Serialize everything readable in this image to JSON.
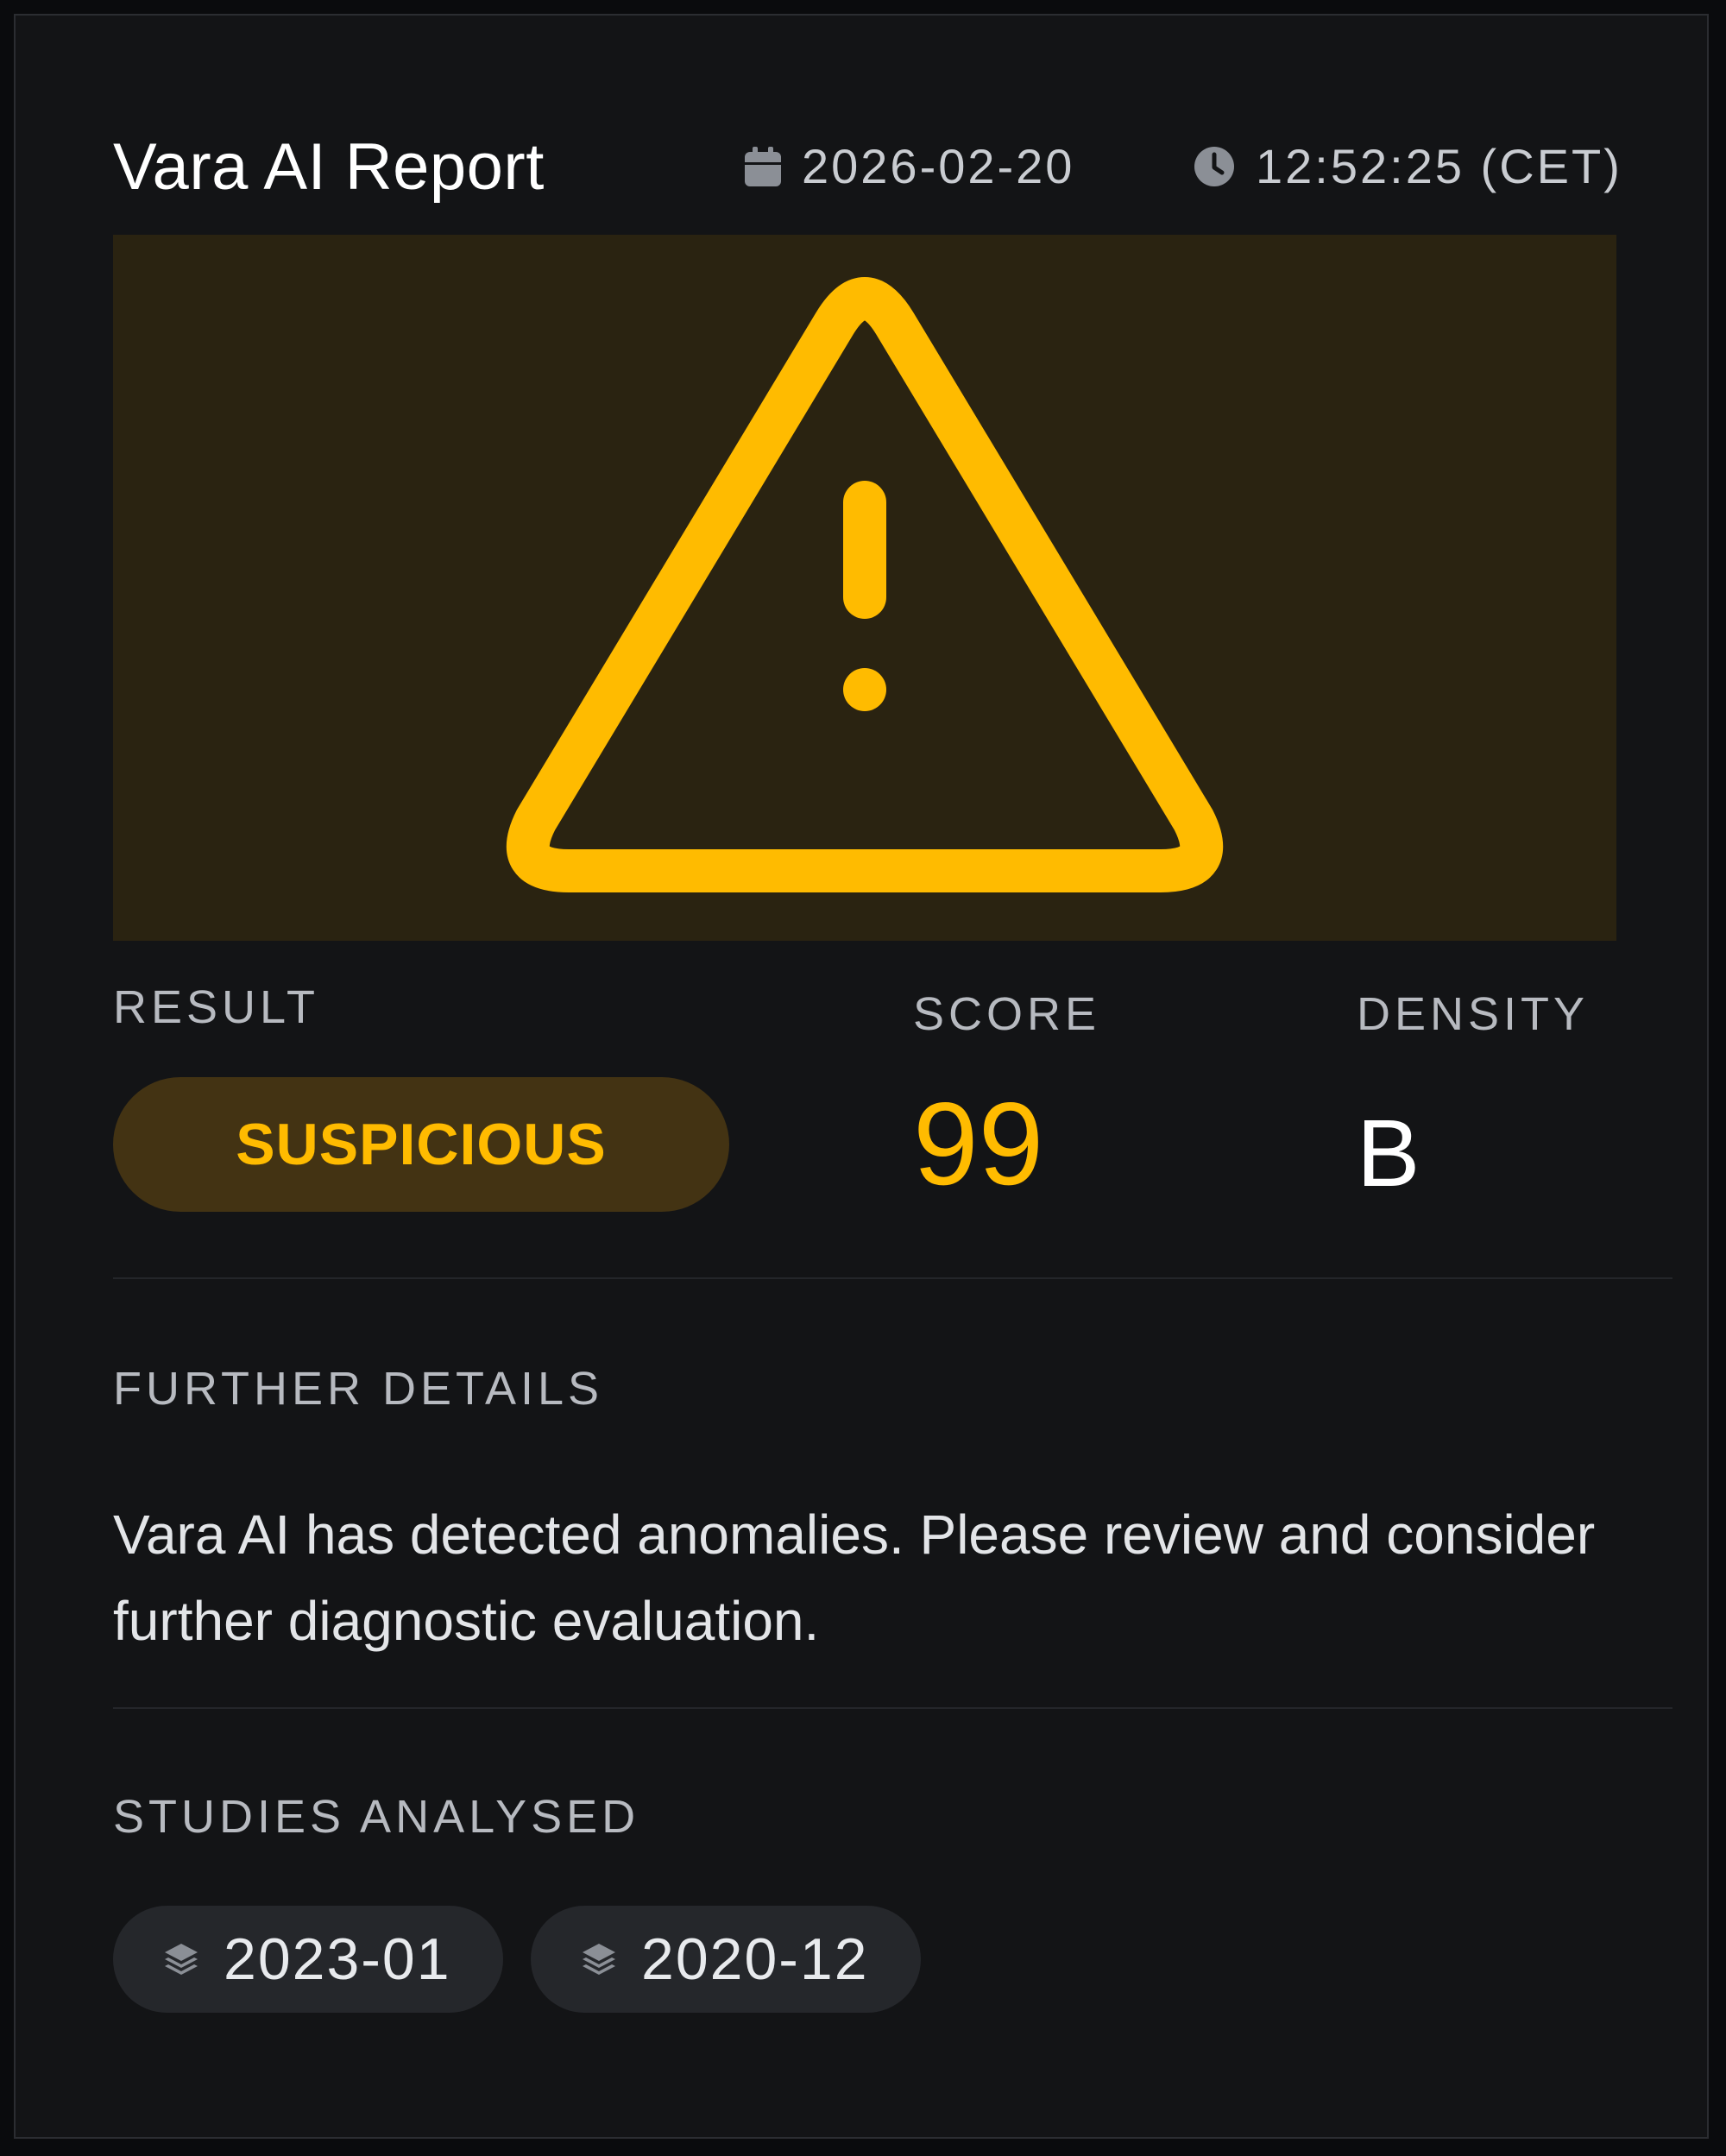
{
  "header": {
    "title": "Vara AI Report",
    "date": "2026-02-20",
    "time": "12:52:25 (CET)",
    "date_icon": "calendar-icon",
    "time_icon": "clock-icon"
  },
  "hero": {
    "icon": "warning-triangle-icon",
    "background_color": "#2a2311",
    "icon_color": "#ffbb00"
  },
  "result": {
    "label": "RESULT",
    "value": "SUSPICIOUS",
    "color": "#ffbb00"
  },
  "score": {
    "label": "SCORE",
    "value": "99"
  },
  "density": {
    "label": "DENSITY",
    "value": "B"
  },
  "details": {
    "label": "FURTHER DETAILS",
    "text": "Vara AI has detected anomalies. Please review and consider further diagnostic evaluation."
  },
  "studies": {
    "label": "STUDIES ANALYSED",
    "items": [
      {
        "label": "2023-01",
        "icon": "layers-icon"
      },
      {
        "label": "2020-12",
        "icon": "layers-icon"
      }
    ]
  }
}
